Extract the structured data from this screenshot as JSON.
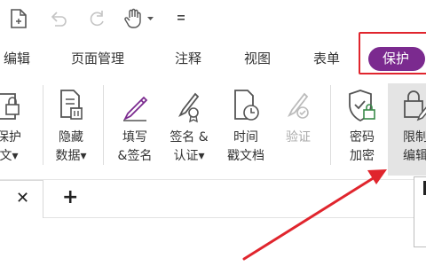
{
  "menu": {
    "tabs": [
      {
        "label": "编辑"
      },
      {
        "label": "页面管理"
      },
      {
        "label": "注释"
      },
      {
        "label": "视图"
      },
      {
        "label": "表单"
      },
      {
        "label": "保护",
        "active": true
      }
    ]
  },
  "ribbon": {
    "buttons": [
      {
        "line1": "保护",
        "line2": "文▾"
      },
      {
        "line1": "隐藏",
        "line2": "数据▾"
      },
      {
        "line1": "填写",
        "line2": "&签名"
      },
      {
        "line1": "签名 &",
        "line2": "认证▾"
      },
      {
        "line1": "时间",
        "line2": "戳文档"
      },
      {
        "line1": "验证",
        "disabled": true
      },
      {
        "line1": "密码",
        "line2": "加密"
      },
      {
        "line1": "限制",
        "line2": "编辑"
      }
    ]
  },
  "doc_tabs": {
    "close": "✕",
    "add": "+"
  },
  "colors": {
    "accent": "#7b2a8f",
    "annotation_red": "#e0252d",
    "icon_green": "#3a8a4a"
  }
}
